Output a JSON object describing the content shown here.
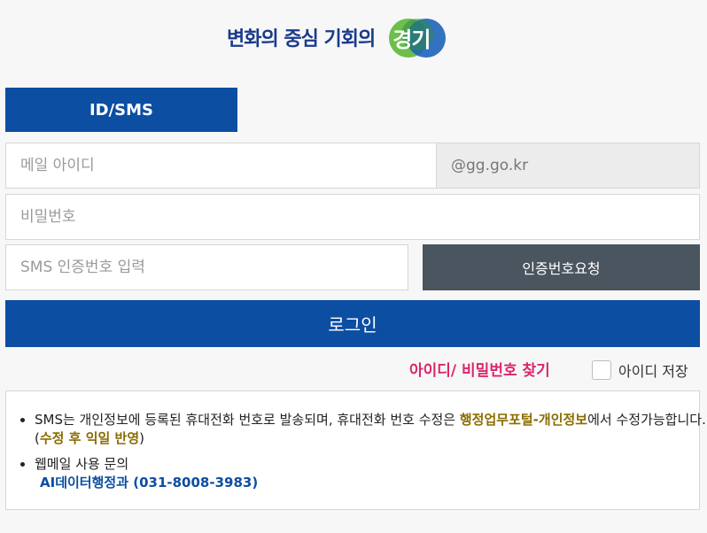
{
  "logo": {
    "text": "변화의 중심 기회의",
    "badge": "경기",
    "colors": {
      "navy": "#1a3a8c",
      "green": "#6cbf4b",
      "blue": "#1d63b7"
    }
  },
  "tab": {
    "label": "ID/SMS"
  },
  "fields": {
    "email_placeholder": "메일 아이디",
    "domain": "@gg.go.kr",
    "password_placeholder": "비밀번호",
    "sms_placeholder": "SMS 인증번호 입력"
  },
  "buttons": {
    "sms_request": "인증번호요청",
    "login": "로그인"
  },
  "links": {
    "find": "아이디/ 비밀번호 찾기"
  },
  "save_id": {
    "label": "아이디 저장",
    "checked": false
  },
  "notice": {
    "item1": {
      "text1": "SMS는 개인정보에 등록된 휴대전화 번호로 발송되며, 휴대전화 번호 수정은 ",
      "highlight1": "행정업무포털-개인정보",
      "text2": "에서 수정가능합니다. (",
      "highlight2": "수정 후 익일 반영",
      "text3": ")"
    },
    "item2": {
      "text": "웹메일 사용 문의",
      "contact": "AI데이터행정과 (031-8008-3983)"
    }
  },
  "colors": {
    "primary": "#0b4ea2",
    "dark_button": "#4a5560",
    "link": "#d9286b",
    "highlight": "#8a6d00"
  }
}
